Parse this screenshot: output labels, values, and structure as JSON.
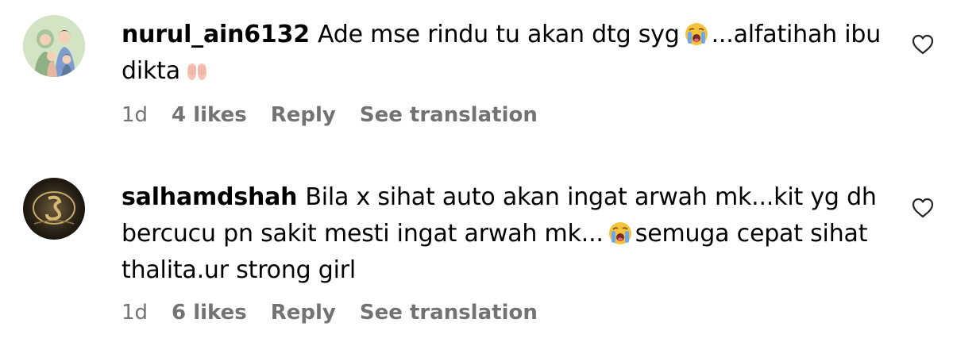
{
  "comments": [
    {
      "username": "nurul_ain6132",
      "text_before_emoji": "Ade mse rindu tu akan dtg syg",
      "emoji_1": "loudly-crying-face",
      "text_after_emoji": "...alfatihah ibu dikta",
      "emoji_2": "palms-up-together",
      "time": "1d",
      "likes": "4 likes",
      "reply_label": "Reply",
      "translation_label": "See translation"
    },
    {
      "username": "salhamdshah",
      "text_before_emoji": "Bila x sihat auto akan ingat arwah mk...kit yg dh bercucu pn sakit mesti ingat arwah mk...",
      "emoji_1": "loudly-crying-face",
      "text_after_emoji": "semuga cepat sihat thalita.ur strong girl",
      "time": "1d",
      "likes": "6 likes",
      "reply_label": "Reply",
      "translation_label": "See translation"
    }
  ],
  "colors": {
    "meta_text": "#737373",
    "text": "#000000",
    "background": "#ffffff"
  }
}
